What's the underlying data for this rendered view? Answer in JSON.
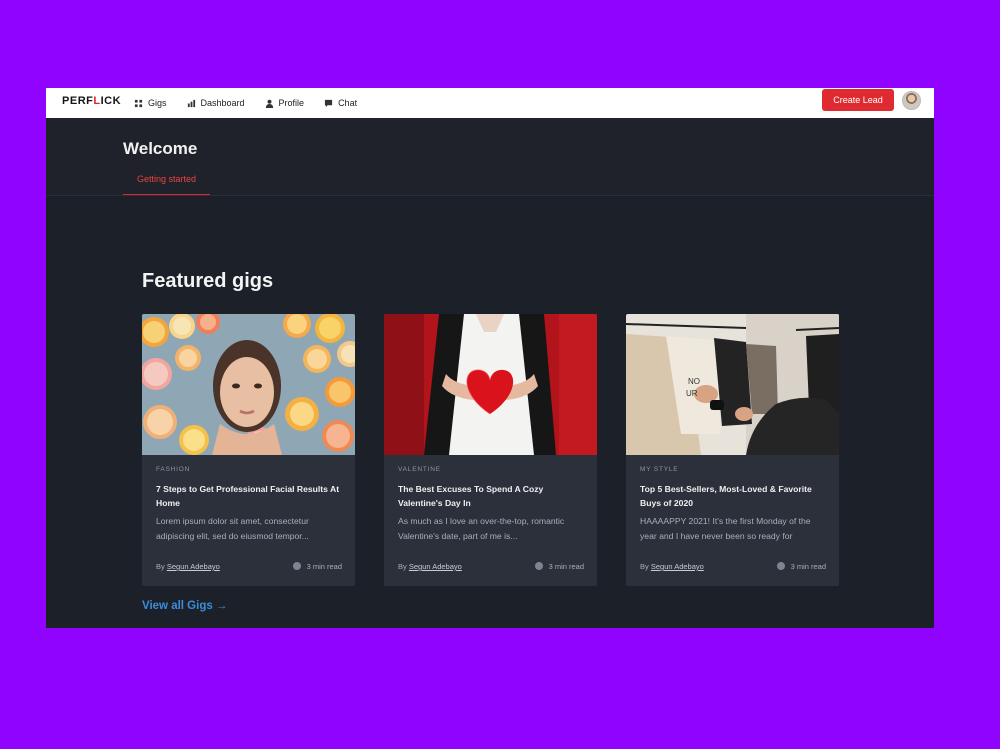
{
  "nav": {
    "logo": "PERFLICK",
    "items": [
      {
        "label": "Gigs",
        "icon": "grid-icon"
      },
      {
        "label": "Dashboard",
        "icon": "bar-chart-icon"
      },
      {
        "label": "Profile",
        "icon": "user-icon"
      },
      {
        "label": "Chat",
        "icon": "chat-icon"
      }
    ],
    "create_lead": "Create Lead"
  },
  "header": {
    "title": "Welcome",
    "tab": "Getting started"
  },
  "featured": {
    "title": "Featured gigs",
    "cards": [
      {
        "category": "FASHION",
        "title": "7 Steps to Get Professional Facial Results At Home",
        "excerpt": "Lorem ipsum dolor sit amet, consectetur adipiscing elit, sed do eiusmod tempor...",
        "by": "By",
        "author": "Segun Adebayo",
        "read": "3 min read"
      },
      {
        "category": "VALENTINE",
        "title": "The Best Excuses To Spend A Cozy Valentine's Day In",
        "excerpt": "As much as I love an over-the-top, romantic Valentine's date, part of me is...",
        "by": "By",
        "author": "Segun Adebayo",
        "read": "3 min read"
      },
      {
        "category": "MY STYLE",
        "title": "Top 5 Best-Sellers, Most-Loved & Favorite Buys of 2020",
        "excerpt": "HAAAAPPY 2021! It's the first Monday of the year and I have never been so ready for",
        "by": "By",
        "author": "Segun Adebayo",
        "read": "3 min read"
      }
    ],
    "view_all": "View all Gigs →"
  },
  "colors": {
    "background": "#8f03ff",
    "accent": "#e0252d",
    "link": "#3d8ddb",
    "panel": "#1c2029",
    "card": "#2b303b"
  }
}
